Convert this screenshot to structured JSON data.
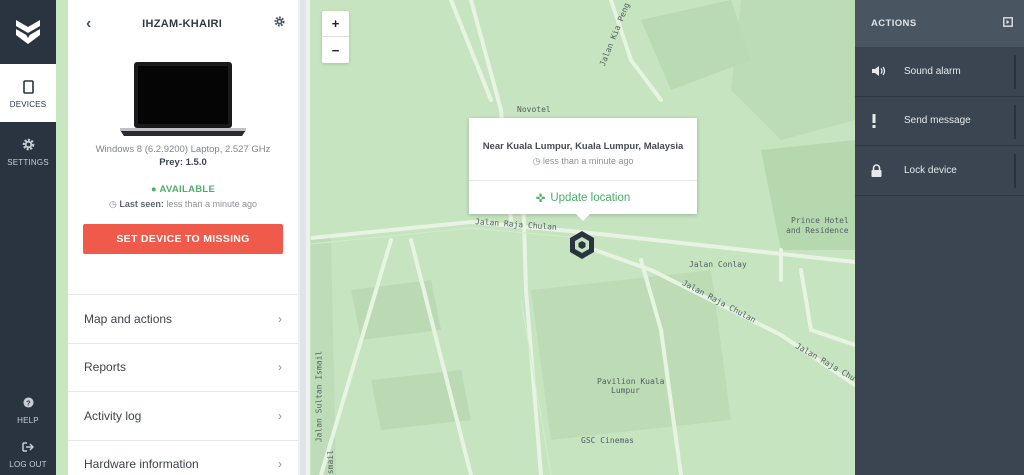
{
  "nav": {
    "items": [
      {
        "label": "DEVICES",
        "icon": "tablet-icon"
      },
      {
        "label": "SETTINGS",
        "icon": "gear-icon"
      }
    ],
    "bottom": [
      {
        "label": "HELP",
        "icon": "help-icon"
      },
      {
        "label": "LOG OUT",
        "icon": "logout-icon"
      }
    ]
  },
  "device": {
    "name": "IHZAM-KHAIRI",
    "spec": "Windows 8 (6.2.9200) Laptop, 2.527 GHz",
    "prey_version": "Prey: 1.5.0",
    "status": "AVAILABLE",
    "last_seen_label": "Last seen:",
    "last_seen_value": "less than a minute ago",
    "missing_button": "SET DEVICE TO MISSING"
  },
  "menu": [
    {
      "label": "Map and actions"
    },
    {
      "label": "Reports"
    },
    {
      "label": "Activity log"
    },
    {
      "label": "Hardware information"
    }
  ],
  "map": {
    "zoom_in": "+",
    "zoom_out": "−",
    "popup_location": "Near Kuala Lumpur, Kuala Lumpur, Malaysia",
    "popup_time": "less than a minute ago",
    "popup_button": "Update location",
    "labels": {
      "novotel": "Novotel",
      "prince": "Prince Hotel",
      "residence": "and Residence",
      "raja_chulan_w": "Jalan Raja Chulan",
      "raja_chulan_e": "Jalan Raja Chulan",
      "raja_chulan_e2": "Jalan Raja Chula",
      "conlay": "Jalan Conlay",
      "kia": "Jalan Kia Peng",
      "pavilion": "Pavilion Kuala",
      "pavilion2": "Lumpur",
      "gsc": "GSC Cinemas",
      "sultan": "Jalan Sultan Ismail",
      "smail": "Ismail"
    }
  },
  "actions": {
    "title": "ACTIONS",
    "items": [
      {
        "label": "Sound alarm",
        "icon": "speaker-icon"
      },
      {
        "label": "Send message",
        "icon": "exclamation-icon"
      },
      {
        "label": "Lock device",
        "icon": "lock-icon"
      }
    ]
  },
  "colors": {
    "nav_bg": "#2a3440",
    "danger": "#ef5a4b",
    "success": "#4cae6a",
    "map_bg": "#c6e4bf",
    "actions_bg": "#3a4551"
  }
}
